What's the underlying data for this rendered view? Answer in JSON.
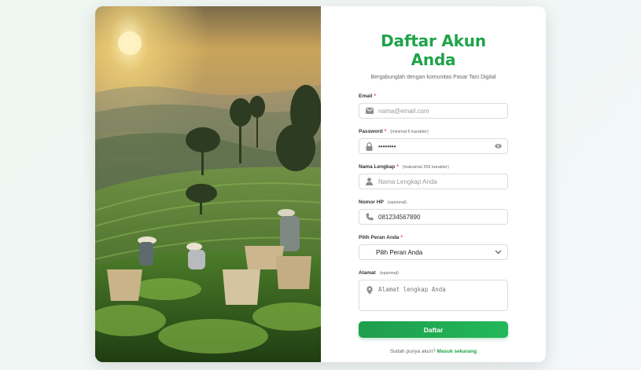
{
  "form": {
    "title": "Daftar Akun Anda",
    "subtitle": "Bergabunglah dengan komunitas Pasar Tani Digital",
    "email": {
      "label": "Email",
      "required": "*",
      "placeholder": "nama@email.com"
    },
    "password": {
      "label": "Password",
      "required": "*",
      "hint": "(minimal 6 karakter)",
      "value": "••••••••"
    },
    "fullname": {
      "label": "Nama Lengkap",
      "required": "*",
      "hint": "(maksimal 255 karakter)",
      "placeholder": "Nama Lengkap Anda"
    },
    "phone": {
      "label": "Nomor HP",
      "hint": "(opsional)",
      "placeholder": "081234567890"
    },
    "role": {
      "label": "Pilih Peran Anda",
      "required": "*",
      "selected": "Pilih Peran Anda"
    },
    "address": {
      "label": "Alamat",
      "hint": "(opsional)",
      "placeholder": "Alamat lengkap Anda"
    },
    "submit_label": "Daftar",
    "footer_text": "Sudah punya akun?",
    "login_link": "Masuk sekarang"
  },
  "colors": {
    "accent": "#1fa34a",
    "required": "#e53935",
    "icon": "#8a8f94"
  },
  "icons": [
    "envelope-icon",
    "lock-icon",
    "eye-icon",
    "user-icon",
    "phone-icon",
    "chevron-down-icon",
    "map-pin-icon"
  ]
}
